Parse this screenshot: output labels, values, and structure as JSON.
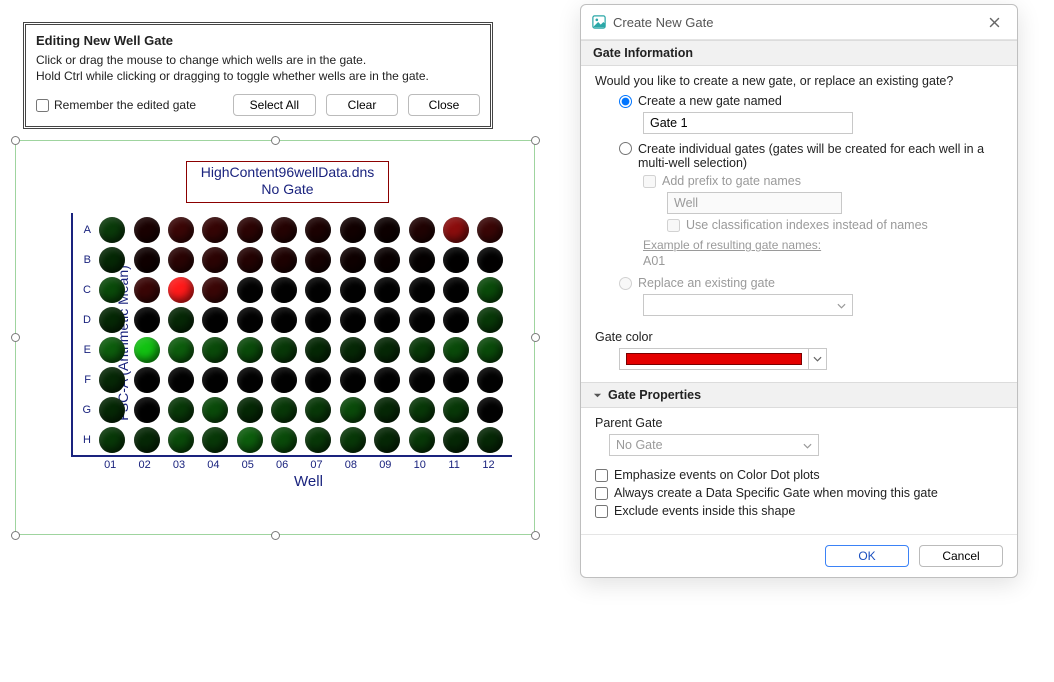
{
  "edit_panel": {
    "title": "Editing New Well Gate",
    "line1": "Click or drag the mouse to change which wells are in the gate.",
    "line2": "Hold Ctrl while clicking or dragging to toggle whether wells are in the gate.",
    "remember_label": "Remember the edited gate",
    "select_all": "Select All",
    "clear": "Clear",
    "close": "Close"
  },
  "plot": {
    "title_line1": "HighContent96wellData.dns",
    "title_line2": "No Gate",
    "y_axis": "FSC-A (Arithmetic Mean)",
    "x_axis": "Well",
    "rows": [
      "A",
      "B",
      "C",
      "D",
      "E",
      "F",
      "G",
      "H"
    ],
    "cols": [
      "01",
      "02",
      "03",
      "04",
      "05",
      "06",
      "07",
      "08",
      "09",
      "10",
      "11",
      "12"
    ],
    "well_colors": [
      [
        "#0a3a0a",
        "#1a0202",
        "#3a0606",
        "#350505",
        "#2c0404",
        "#250303",
        "#1c0202",
        "#120101",
        "#0d0101",
        "#200303",
        "#8b0d0d",
        "#3a0606"
      ],
      [
        "#052805",
        "#100101",
        "#2a0404",
        "#2c0404",
        "#240303",
        "#1e0202",
        "#160202",
        "#0f0101",
        "#0a0101",
        "#050000",
        "#020000",
        "#020000"
      ],
      [
        "#0a4a0a",
        "#3a0606",
        "#ff1a1a",
        "#3a0606",
        "#020202",
        "#020202",
        "#020202",
        "#020202",
        "#020202",
        "#020202",
        "#020202",
        "#0a4a0a"
      ],
      [
        "#052805",
        "#020202",
        "#062806",
        "#020202",
        "#020202",
        "#020202",
        "#020202",
        "#020202",
        "#020202",
        "#020202",
        "#020202",
        "#083808"
      ],
      [
        "#0d5d0d",
        "#12c212",
        "#0d5d0d",
        "#0a4a0a",
        "#0a4a0a",
        "#083808",
        "#052805",
        "#062806",
        "#062806",
        "#083808",
        "#0a4a0a",
        "#0a4a0a"
      ],
      [
        "#062806",
        "#020202",
        "#020202",
        "#020202",
        "#020202",
        "#020202",
        "#020202",
        "#020202",
        "#020202",
        "#020202",
        "#020202",
        "#020202"
      ],
      [
        "#052805",
        "#020202",
        "#083808",
        "#0a4a0a",
        "#052805",
        "#083808",
        "#083808",
        "#0a4a0a",
        "#062806",
        "#083808",
        "#083808",
        "#020202"
      ],
      [
        "#083808",
        "#062806",
        "#0a4a0a",
        "#083808",
        "#0d5d0d",
        "#0a4a0a",
        "#083808",
        "#083808",
        "#062806",
        "#083808",
        "#062806",
        "#062806"
      ]
    ]
  },
  "chart_data": {
    "type": "heatmap",
    "title": "HighContent96wellData.dns — No Gate",
    "xlabel": "Well",
    "ylabel": "FSC-A (Arithmetic Mean)",
    "row_labels": [
      "A",
      "B",
      "C",
      "D",
      "E",
      "F",
      "G",
      "H"
    ],
    "col_labels": [
      "01",
      "02",
      "03",
      "04",
      "05",
      "06",
      "07",
      "08",
      "09",
      "10",
      "11",
      "12"
    ],
    "note": "Well-plate heatmap; colors encode FSC-A arithmetic mean per well (green=low, black=mid, red=high). Exact numeric values not shown on-screen; colors captured under plot.well_colors."
  },
  "dialog": {
    "title": "Create New Gate",
    "section_info": "Gate Information",
    "prompt": "Would you like to create a new gate, or replace an existing gate?",
    "opt_create": "Create a new gate named",
    "gate_name_value": "Gate 1",
    "opt_individual_l1": "Create individual gates (gates will be created for each well in a",
    "opt_individual_l2": "multi-well selection)",
    "add_prefix": "Add prefix to gate names",
    "prefix_value": "Well",
    "use_class": "Use classification indexes instead of names",
    "example_hd": "Example of resulting gate names:",
    "example_val": "A01",
    "opt_replace": "Replace an existing gate",
    "replace_select": "",
    "gate_color_label": "Gate color",
    "gate_color": "#e40000",
    "section_props": "Gate Properties",
    "parent_gate_label": "Parent Gate",
    "parent_gate_value": "No Gate",
    "chk_emphasize": "Emphasize events on Color Dot plots",
    "chk_always": "Always create a Data Specific Gate when moving this gate",
    "chk_exclude": "Exclude events inside this shape",
    "ok": "OK",
    "cancel": "Cancel"
  }
}
